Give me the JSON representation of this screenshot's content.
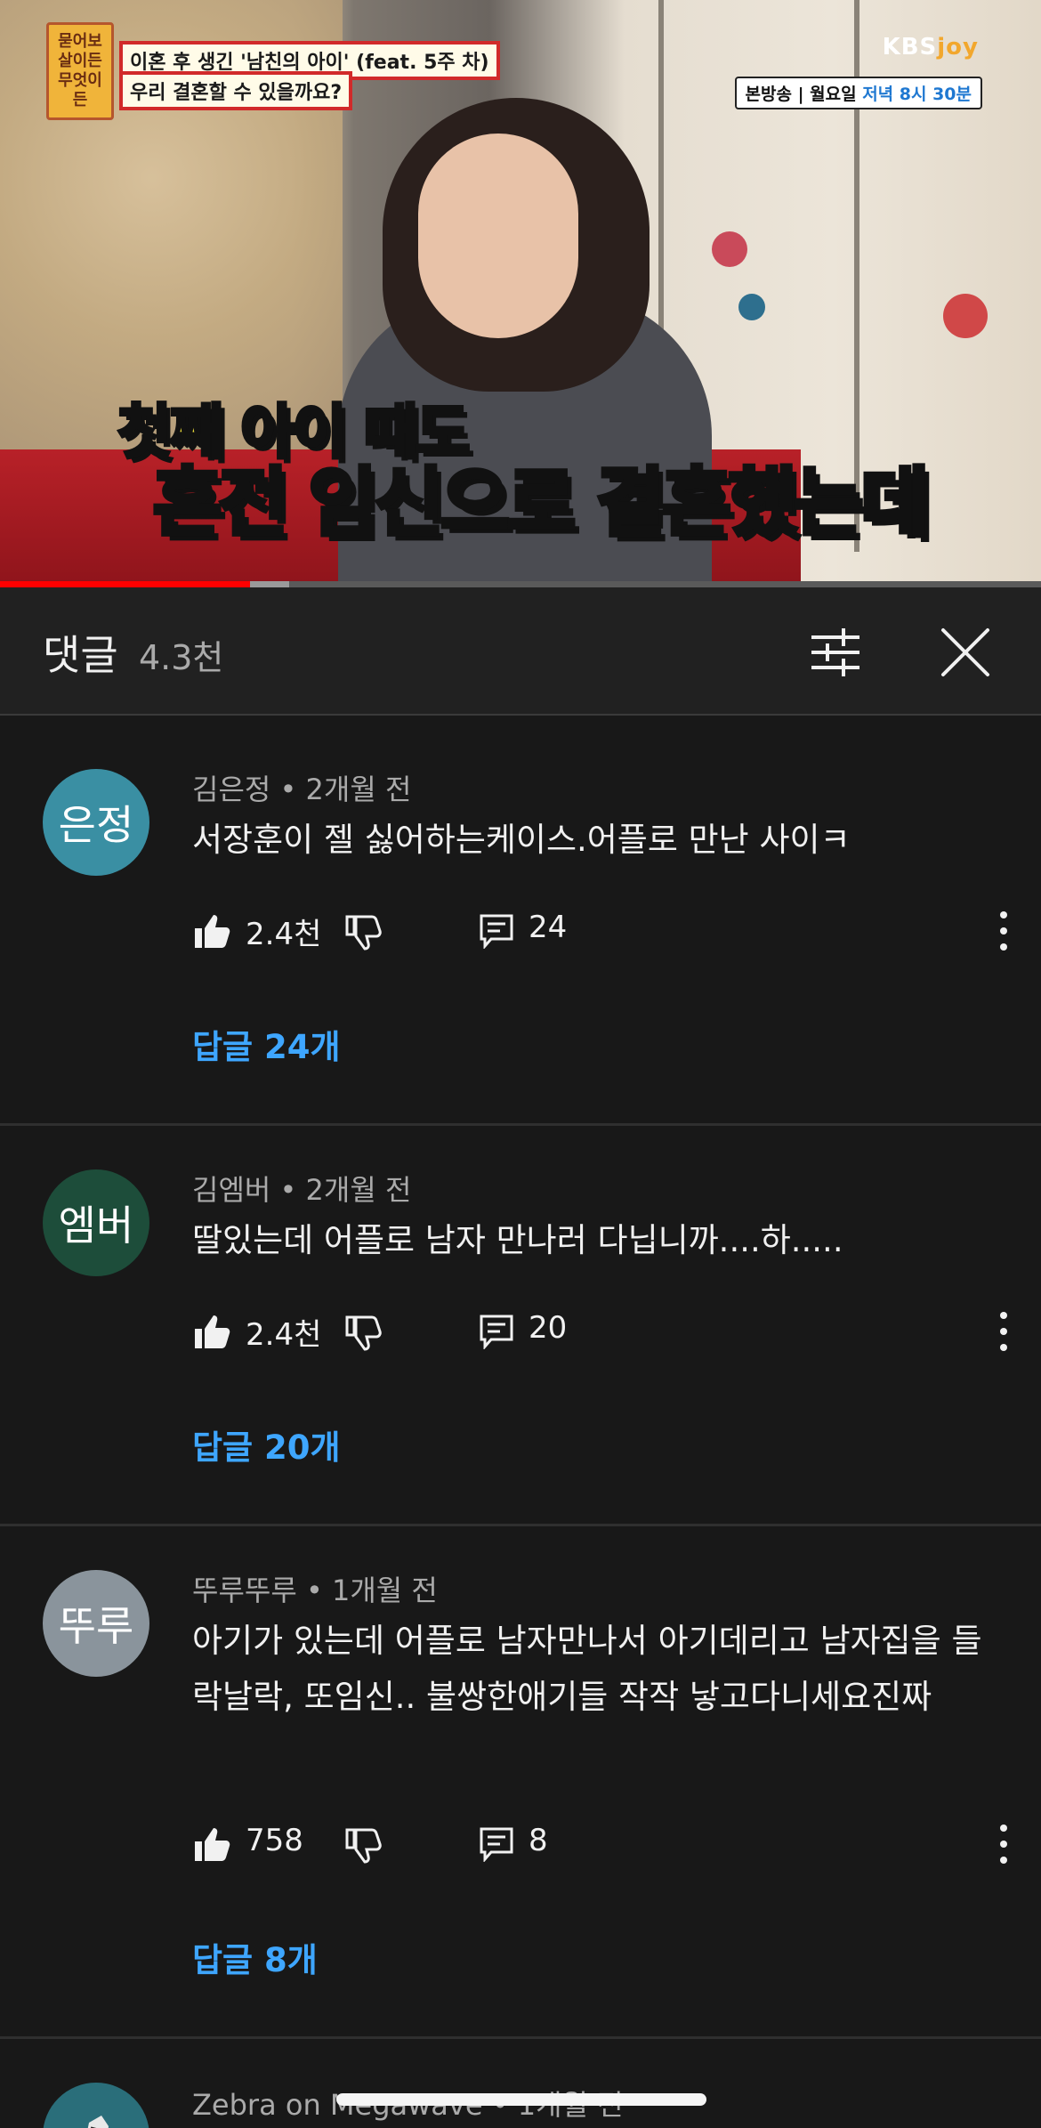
{
  "video": {
    "badge": "묻어보살이든 무엇이든",
    "tag_line1": "이혼 후 생긴 '남친의 아이' (feat. 5주 차)",
    "tag_line2": "우리 결혼할 수 있을까요?",
    "channel_logo_a": "KBS",
    "channel_logo_b": "joy",
    "broadcast_prefix": "본방송 | 월요일 ",
    "broadcast_time": "저녁 8시 30분",
    "caption1_a": "첫째 아이",
    "caption1_b": " 때도",
    "caption2_a": "혼전 임신으로 결혼",
    "caption2_b": "했는데",
    "progress": 0.24
  },
  "panel": {
    "title": "댓글",
    "count": "4.3천"
  },
  "comments": [
    {
      "avatar_text": "은정",
      "avatar_color": "#3a8fa3",
      "author": "김은정",
      "time": "2개월 전",
      "text": "서장훈이 젤 싫어하는케이스.어플로 만난 사이ㅋ",
      "likes": "2.4천",
      "reply_count": "24",
      "replies_label": "답글 24개"
    },
    {
      "avatar_text": "엠버",
      "avatar_color": "#1d4d3a",
      "author": "김엠버",
      "time": "2개월 전",
      "text": "딸있는데 어플로 남자 만나러 다닙니까....하.....",
      "likes": "2.4천",
      "reply_count": "20",
      "replies_label": "답글 20개"
    },
    {
      "avatar_text": "뚜루",
      "avatar_color": "#8a949c",
      "author": "뚜루뚜루",
      "time": "1개월 전",
      "text": "아기가 있는데 어플로 남자만나서 아기데리고 남자집을 들락날락, 또임신..    불쌍한애기들 작작 낳고다니세요진짜",
      "likes": "758",
      "reply_count": "8",
      "replies_label": "답글 8개"
    },
    {
      "author": "Zebra on Megawave",
      "time": "1개월 전",
      "avatar_color": "#2a6e7a"
    }
  ],
  "icons": {
    "filter": "filter-icon",
    "close": "close-icon",
    "like": "thumbs-up-icon",
    "dislike": "thumbs-down-icon",
    "reply": "reply-icon",
    "more": "more-vertical-icon"
  },
  "colors": {
    "background": "#181818",
    "link": "#3ea6ff",
    "progress": "#ff0000"
  }
}
